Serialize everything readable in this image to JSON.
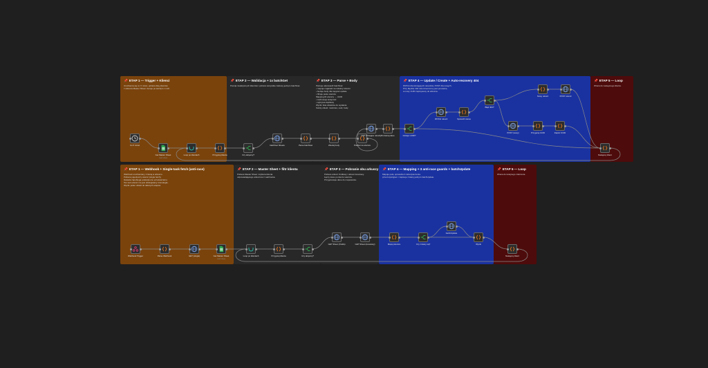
{
  "colors": {
    "canvas": "#1f1f1f",
    "sticky_orange": "#7a430c",
    "sticky_gray": "#282828",
    "sticky_blue": "#1a32a0",
    "sticky_red": "#4e0b0b",
    "node_bg": "#2d2d2d",
    "wire": "#8a8a8a",
    "green_icon": "#2fa84f",
    "orange_icon": "#e7751d",
    "teal_icon": "#26b8a5",
    "gold_icon": "#d9a13b",
    "blue_icon": "#7aa0e6"
  },
  "stickies": [
    {
      "title": "ETAP 1 — Trigger + Klienci",
      "body": [
        "Uruchamia się co X minut, pobiera listę klientów",
        "z arkusza Master Sheet i iteruje po każdym z nich."
      ]
    },
    {
      "title": "ETAP 2 — Walidacja + 1x batchGet",
      "body": [
        "Pomija nieaktywnych klientów i pobiera wszystkie zakresy jednym batchGet."
      ]
    },
    {
      "title": "ETAP 3 — Parse + Body",
      "body": [
        "Parsuje odpowiedź batchGet:",
        "• mapuje nagłówki na indeksy kolumn",
        "• buduje body dla zapytań update",
        "• filtruje puste wiersze",
        "Mapping ID wierszy → UUID",
        "• zachowuje kolejność",
        "• wykrywa duplikaty",
        "Wynik: lista obiektów do wysłania",
        "Każdy obiekt: rowIndex, uuid, body"
      ]
    },
    {
      "title": "ETAP 4 — Update / Create + Auto-recovery 404",
      "body": [
        "PATCH dla istniejących rekordów, POST dla nowych.",
        "Przy błędzie 404 rekord tworzony jest ponownie,",
        "a nowy UUID zapisywany do arkusza."
      ]
    },
    {
      "title": "ETAP 5 — Loop",
      "body": [
        "Wraca do następnego klienta."
      ]
    },
    {
      "title": "ETAP 1 — Webhook + Single-task fetch (anti-race)",
      "body": [
        "Webhook uruchamiany zmianą w arkuszu.",
        "Pobiera pojedynczy wiersz (single fetch),",
        "blokada zapobiega podwójnemu przetwarzaniu.",
        "Ten sam wiersz nie jest obsługiwany równolegle.",
        "Wynik: jeden obiekt do dalszych etapów."
      ]
    },
    {
      "title": "ETAP 2 — Master Sheet + filtr klienta",
      "body": [
        "Pobiera Master Sheet i wybiera klienta",
        "odpowiadającego arkuszowi z webhooka."
      ]
    },
    {
      "title": "ETAP 3 — Pobranie obu arkuszy",
      "body": [
        "Pobiera arkusz źródłowy i arkusz docelowy.",
        "Łączy dane po kluczu wiersza.",
        "Przygotowuje dane do mapowania."
      ]
    },
    {
      "title": "ETAP 4 — Mapping + 3 anti-race guards + batchUpdate",
      "body": [
        "Mapuje pola, sprawdza 3 zabezpieczenia",
        "przed wyścigiem i zapisuje zmiany jednym batchUpdate."
      ]
    },
    {
      "title": "ETAP 5 — Loop",
      "body": [
        "Wraca do kolejnego zdarzenia."
      ]
    }
  ],
  "nodes": [
    {
      "label": "Co 5 minut",
      "sub": "",
      "icon": "clock-icon"
    },
    {
      "label": "Get Master Sheet",
      "sub": "read: sheet",
      "icon": "google-sheets-icon"
    },
    {
      "label": "Loop po klientach",
      "sub": "",
      "icon": "loop-icon"
    },
    {
      "label": "Przygotuj klienta",
      "sub": "",
      "icon": "code-icon"
    },
    {
      "label": "Czy aktywny?",
      "sub": "",
      "icon": "if-icon"
    },
    {
      "label": "batchGet Sheets",
      "sub": "",
      "icon": "http-icon"
    },
    {
      "label": "Parse batchGet",
      "sub": "",
      "icon": "code-icon"
    },
    {
      "label": "Zbuduj body",
      "sub": "",
      "icon": "code-icon"
    },
    {
      "label": "Podziel na wiersze",
      "sub": "",
      "icon": "code-icon"
    },
    {
      "label": "GET istniejące rekordy",
      "sub": "",
      "icon": "http-icon"
    },
    {
      "label": "Porównaj dane",
      "sub": "",
      "icon": "code-icon"
    },
    {
      "label": "Istnieje UUID?",
      "sub": "",
      "icon": "if-icon"
    },
    {
      "label": "PATCH rekord",
      "sub": "",
      "icon": "http-icon"
    },
    {
      "label": "Sprawdź status",
      "sub": "",
      "icon": "code-icon"
    },
    {
      "label": "Błąd 404?",
      "sub": "",
      "icon": "if-icon"
    },
    {
      "label": "POST (nowy)",
      "sub": "",
      "icon": "http-icon"
    },
    {
      "label": "Przygotuj UUID",
      "sub": "",
      "icon": "code-icon"
    },
    {
      "label": "Zapisz UUID",
      "sub": "",
      "icon": "code-icon"
    },
    {
      "label": "Nowy rekord",
      "sub": "",
      "icon": "code-icon"
    },
    {
      "label": "POST rekord",
      "sub": "",
      "icon": "http-icon"
    },
    {
      "label": "Następny klient",
      "sub": "",
      "icon": "code-icon"
    },
    {
      "label": "Webhook Trigger",
      "sub": "",
      "icon": "webhook-icon"
    },
    {
      "label": "Parse Webhook",
      "sub": "",
      "icon": "code-icon"
    },
    {
      "label": "GET (single)",
      "sub": "",
      "icon": "http-icon"
    },
    {
      "label": "Get Master Sheet",
      "sub": "read: sheet",
      "icon": "google-sheets-icon"
    },
    {
      "label": "Loop po klientach",
      "sub": "",
      "icon": "loop-icon"
    },
    {
      "label": "Przygotuj klienta",
      "sub": "",
      "icon": "code-icon"
    },
    {
      "label": "Czy aktywny?",
      "sub": "",
      "icon": "if-icon"
    },
    {
      "label": "GET Sheet (źródło)",
      "sub": "",
      "icon": "http-icon"
    },
    {
      "label": "GET Sheet (docelowy)",
      "sub": "",
      "icon": "http-icon"
    },
    {
      "label": "Mapuj wiersze",
      "sub": "",
      "icon": "code-icon"
    },
    {
      "label": "Czy zmiany są?",
      "sub": "",
      "icon": "if-icon"
    },
    {
      "label": "batchUpdate",
      "sub": "",
      "icon": "http-icon"
    },
    {
      "label": "Wynik",
      "sub": "",
      "icon": "code-icon"
    },
    {
      "label": "Następny klient",
      "sub": "",
      "icon": "code-icon"
    }
  ]
}
